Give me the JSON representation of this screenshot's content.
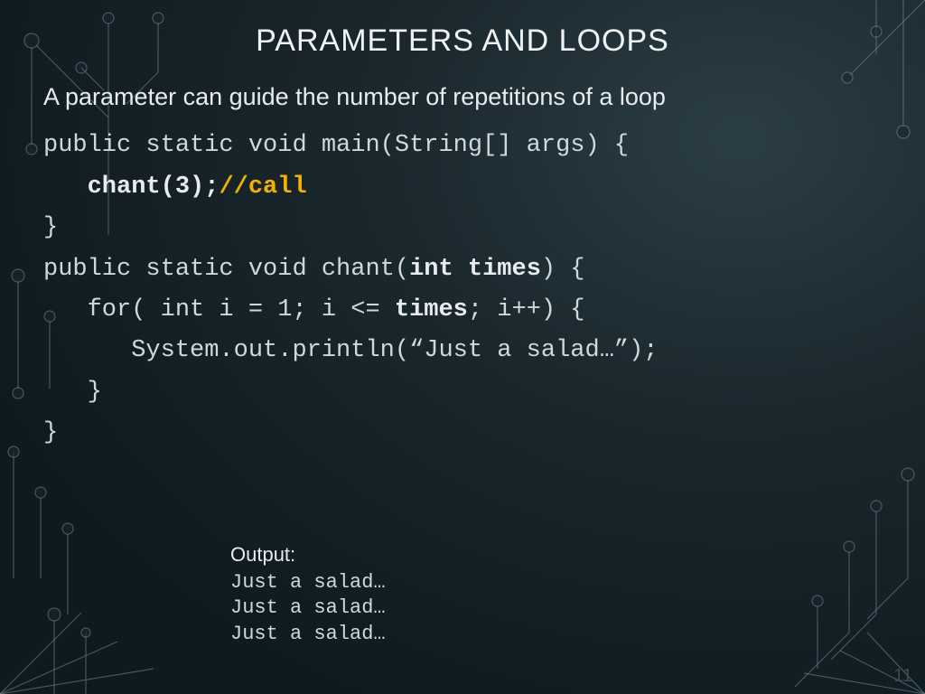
{
  "title": "PARAMETERS AND LOOPS",
  "para": "A parameter can guide the number of repetitions of a loop",
  "code": {
    "l1a": "public static void main(String[] args) {",
    "l2_indent": "   ",
    "l2_call": "chant(3);",
    "l2_comment": "//call",
    "l3": "}",
    "l4a": "public static void chant(",
    "l4b": "int times",
    "l4c": ") {",
    "l5a": "   for( int i = 1; i <= ",
    "l5b": "times",
    "l5c": "; i++) {",
    "l6": "      System.out.println(“Just a salad…”);",
    "l7": "   }",
    "l8": "}"
  },
  "output": {
    "label": "Output:",
    "lines": [
      "Just a salad…",
      "Just a salad…",
      "Just a salad…"
    ]
  },
  "page_number": "11"
}
